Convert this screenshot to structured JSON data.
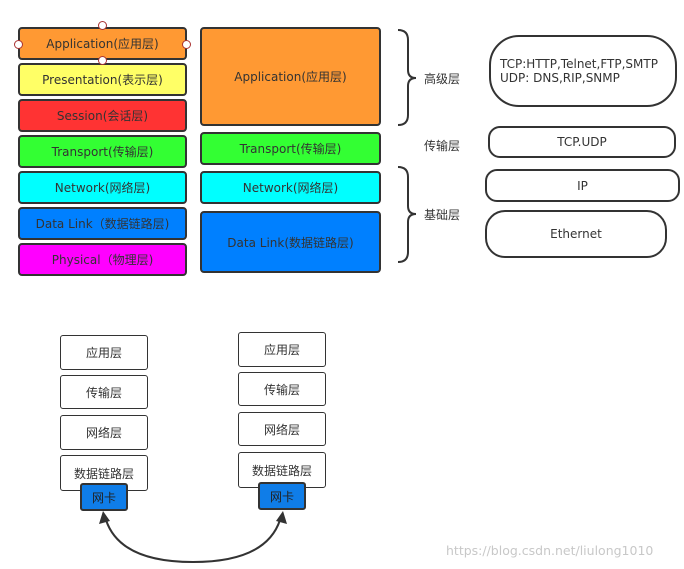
{
  "osi_model": {
    "layers": [
      {
        "label": "Application(应用层)",
        "color": "#ff9933"
      },
      {
        "label": "Presentation(表示层)",
        "color": "#ffff66"
      },
      {
        "label": "Session(会话层)",
        "color": "#ff3333"
      },
      {
        "label": "Transport(传输层)",
        "color": "#33ff33"
      },
      {
        "label": "Network(网络层)",
        "color": "#00ffff"
      },
      {
        "label": "Data Link（数据链路层)",
        "color": "#0080ff"
      },
      {
        "label": "Physical（物理层)",
        "color": "#ff00ff"
      }
    ]
  },
  "tcpip_model": {
    "layers": [
      {
        "label": "Application(应用层)",
        "color": "#ff9933"
      },
      {
        "label": "Transport(传输层)",
        "color": "#33ff33"
      },
      {
        "label": "Network(网络层)",
        "color": "#00ffff"
      },
      {
        "label": "Data Link(数据链路层)",
        "color": "#0080ff"
      }
    ]
  },
  "groups": {
    "high": "高级层",
    "transport": "传输层",
    "base": "基础层"
  },
  "protocols": {
    "app_line1": "TCP:HTTP,Telnet,FTP,SMTP",
    "app_line2": "UDP: DNS,RIP,SNMP",
    "transport": "TCP.UDP",
    "network": "IP",
    "link": "Ethernet"
  },
  "hosts": [
    {
      "layers": [
        "应用层",
        "传输层",
        "网络层",
        "数据链路层"
      ],
      "nic": "网卡"
    },
    {
      "layers": [
        "应用层",
        "传输层",
        "网络层",
        "数据链路层"
      ],
      "nic": "网卡"
    }
  ],
  "watermark": "https://blog.csdn.net/liulong1010"
}
